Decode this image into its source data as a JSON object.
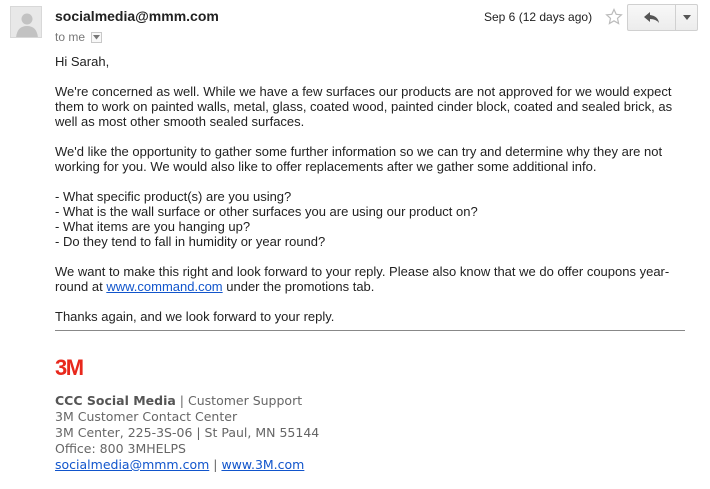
{
  "header": {
    "sender": "socialmedia@mmm.com",
    "recipient_label": "to me",
    "date": "Sep 6 (12 days ago)"
  },
  "icons": {
    "avatar": "person-silhouette-icon",
    "details": "dropdown-arrow-icon",
    "star": "star-outline-icon",
    "reply": "reply-arrow-icon",
    "more": "chevron-down-icon"
  },
  "message": {
    "greeting": "Hi Sarah,",
    "para1": "We're concerned as well. While we have a few surfaces our products are not approved for we would expect them to work on painted walls, metal, glass, coated wood, painted cinder block, coated and sealed brick, as well as most other smooth sealed surfaces.",
    "para2": "We'd like the opportunity to gather some further information so we can try and determine why they are not working for you. We would also like to offer replacements after we gather some additional info.",
    "questions": [
      "- What specific product(s) are you using?",
      "- What is the wall surface or other surfaces you are using our product on?",
      "- What items are you hanging up?",
      "- Do they tend to fall in humidity or year round?"
    ],
    "para3_before": "We want to make this right and look forward to your reply. Please also know that we do offer coupons year-round at ",
    "para3_link": "www.command.com",
    "para3_after": " under the promotions tab.",
    "closing": "Thanks again, and we look forward to your reply."
  },
  "signature": {
    "logo": "3M",
    "team": "CCC Social Media",
    "separator": " | ",
    "team_role": "Customer Support",
    "center": "3M Customer Contact Center",
    "address": "3M Center, 225-3S-06 | St Paul, MN 55144",
    "office": "Office: 800 3MHELPS",
    "email": "socialmedia@mmm.com",
    "link_separator": " | ",
    "website": "www.3M.com"
  },
  "colors": {
    "link": "#1155cc",
    "logo_red": "#e8281c",
    "signature_gray": "#666666"
  }
}
